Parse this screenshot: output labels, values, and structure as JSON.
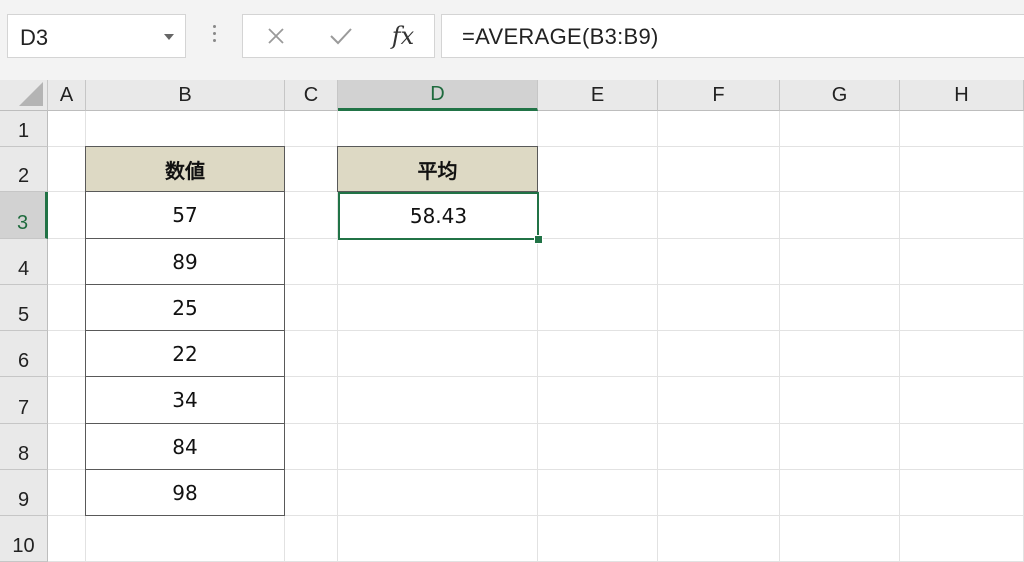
{
  "name_box": {
    "value": "D3"
  },
  "formula_bar": {
    "formula": "=AVERAGE(B3:B9)",
    "fx_label": "fx"
  },
  "icons": {
    "cancel": "close-icon",
    "enter": "checkmark-icon",
    "fx": "function-icon",
    "name_box_dropdown": "chevron-down-icon"
  },
  "columns": [
    "A",
    "B",
    "C",
    "D",
    "E",
    "F",
    "G",
    "H"
  ],
  "rows": [
    "1",
    "2",
    "3",
    "4",
    "5",
    "6",
    "7",
    "8",
    "9",
    "10"
  ],
  "active_cell": "D3",
  "colors": {
    "header_fill": "#ddd9c4",
    "selection": "#217346",
    "border": "#595959"
  },
  "cells": {
    "B2": "数値",
    "B3": "57",
    "B4": "89",
    "B5": "25",
    "B6": "22",
    "B7": "34",
    "B8": "84",
    "B9": "98",
    "D2": "平均",
    "D3": "58.43"
  }
}
